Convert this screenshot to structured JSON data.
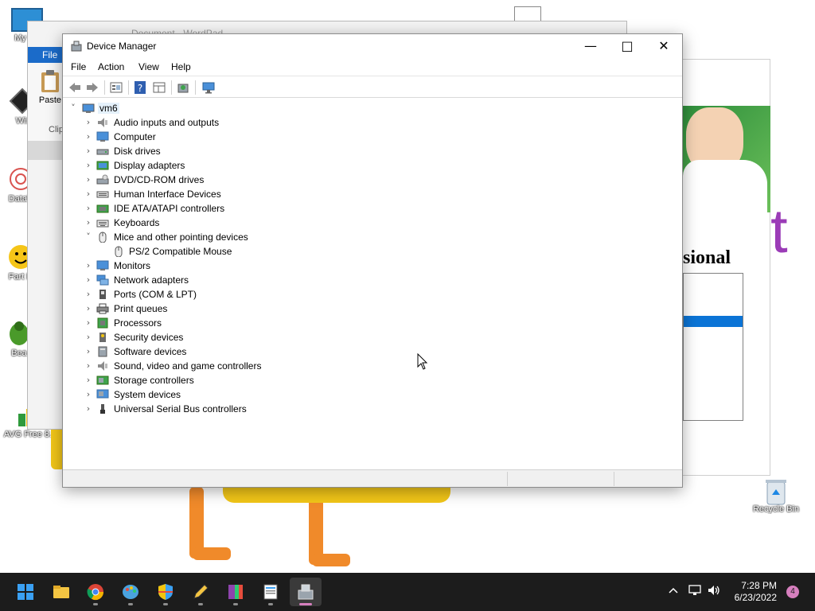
{
  "desktop": {
    "icons": [
      {
        "label": "My Co",
        "icon": "computer-icon"
      },
      {
        "label": "Wir",
        "icon": "winamp-icon"
      },
      {
        "label": "DataV",
        "icon": "datav-icon"
      },
      {
        "label": "Fart D",
        "icon": "smiley-icon"
      },
      {
        "label": "Bea",
        "icon": "bug-icon"
      },
      {
        "label": "AVG Free 8.5",
        "icon": "avg-icon"
      }
    ],
    "recycle_bin": {
      "label": "Recycle Bin",
      "icon": "recycle-bin-icon"
    },
    "top_file_icon": "document-icon"
  },
  "wordpad": {
    "title": "Document - WordPad",
    "file_tab": "File",
    "paste_label": "Paste",
    "clipboard_group": "Clip"
  },
  "background_window": {
    "heading_fragment": "sional",
    "big_letter": "t"
  },
  "device_manager": {
    "title": "Device Manager",
    "title_icon": "device-manager-icon",
    "menu": [
      "File",
      "Action",
      "View",
      "Help"
    ],
    "toolbar": [
      "back-arrow-icon",
      "forward-arrow-icon",
      "properties-icon",
      "help-icon",
      "details-view-icon",
      "scan-hardware-icon",
      "display-monitor-icon"
    ],
    "root": {
      "label": "vm6",
      "icon": "computer-icon",
      "expanded": true
    },
    "nodes": [
      {
        "label": "Audio inputs and outputs",
        "icon": "speaker-icon",
        "expanded": false
      },
      {
        "label": "Computer",
        "icon": "monitor-icon",
        "expanded": false
      },
      {
        "label": "Disk drives",
        "icon": "disk-drive-icon",
        "expanded": false
      },
      {
        "label": "Display adapters",
        "icon": "display-adapter-icon",
        "expanded": false
      },
      {
        "label": "DVD/CD-ROM drives",
        "icon": "dvd-drive-icon",
        "expanded": false
      },
      {
        "label": "Human Interface Devices",
        "icon": "hid-icon",
        "expanded": false
      },
      {
        "label": "IDE ATA/ATAPI controllers",
        "icon": "ide-controller-icon",
        "expanded": false
      },
      {
        "label": "Keyboards",
        "icon": "keyboard-icon",
        "expanded": false
      },
      {
        "label": "Mice and other pointing devices",
        "icon": "mouse-icon",
        "expanded": true,
        "children": [
          {
            "label": "PS/2 Compatible Mouse",
            "icon": "mouse-icon"
          }
        ]
      },
      {
        "label": "Monitors",
        "icon": "monitor-icon",
        "expanded": false
      },
      {
        "label": "Network adapters",
        "icon": "network-adapter-icon",
        "expanded": false
      },
      {
        "label": "Ports (COM & LPT)",
        "icon": "port-icon",
        "expanded": false
      },
      {
        "label": "Print queues",
        "icon": "printer-icon",
        "expanded": false
      },
      {
        "label": "Processors",
        "icon": "processor-icon",
        "expanded": false
      },
      {
        "label": "Security devices",
        "icon": "security-key-icon",
        "expanded": false
      },
      {
        "label": "Software devices",
        "icon": "software-device-icon",
        "expanded": false
      },
      {
        "label": "Sound, video and game controllers",
        "icon": "speaker-icon",
        "expanded": false
      },
      {
        "label": "Storage controllers",
        "icon": "storage-controller-icon",
        "expanded": false
      },
      {
        "label": "System devices",
        "icon": "system-devices-icon",
        "expanded": false
      },
      {
        "label": "Universal Serial Bus controllers",
        "icon": "usb-icon",
        "expanded": false
      }
    ]
  },
  "taskbar": {
    "apps": [
      {
        "name": "start-button",
        "icon": "windows-logo-icon",
        "running": false,
        "active": false
      },
      {
        "name": "file-explorer",
        "icon": "folder-icon",
        "running": false,
        "active": false
      },
      {
        "name": "chrome",
        "icon": "chrome-icon",
        "running": true,
        "active": false
      },
      {
        "name": "paint",
        "icon": "paint-palette-icon",
        "running": true,
        "active": false
      },
      {
        "name": "security",
        "icon": "shield-icon",
        "running": true,
        "active": false
      },
      {
        "name": "sketch",
        "icon": "pencil-icon",
        "running": true,
        "active": false
      },
      {
        "name": "winrar",
        "icon": "winrar-icon",
        "running": true,
        "active": false
      },
      {
        "name": "wordpad",
        "icon": "wordpad-icon",
        "running": true,
        "active": false
      },
      {
        "name": "device-manager",
        "icon": "device-manager-icon",
        "running": true,
        "active": true
      }
    ],
    "tray_icons": [
      "chevron-up-icon",
      "network-icon",
      "volume-icon"
    ],
    "time": "7:28 PM",
    "date": "6/23/2022",
    "notifications": "4"
  },
  "colors": {
    "taskbar": "#1c1c1c",
    "accent_blue": "#1b6bc9",
    "selection": "#e5f1fb",
    "active_indicator": "#d67fbe"
  }
}
